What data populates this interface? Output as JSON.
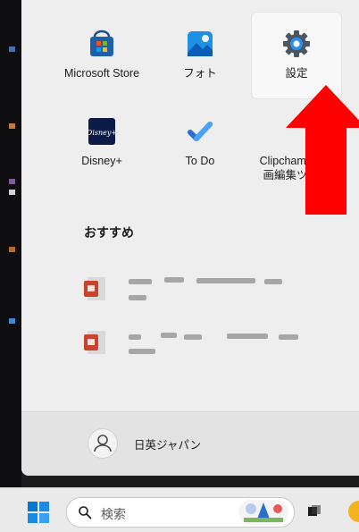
{
  "pinned_apps": [
    {
      "label": "Microsoft Store",
      "icon": "microsoft-store-icon"
    },
    {
      "label": "フォト",
      "icon": "photos-icon"
    },
    {
      "label": "設定",
      "icon": "settings-gear-icon"
    },
    {
      "label": "Disney+",
      "icon": "disney-plus-icon"
    },
    {
      "label": "To Do",
      "icon": "todo-check-icon"
    },
    {
      "label": "Clipchamp - 動",
      "label_line2": "画編集ツール",
      "icon": "clipchamp-icon"
    }
  ],
  "recommended": {
    "title": "おすすめ",
    "items": [
      {
        "icon": "office-document-icon"
      },
      {
        "icon": "office-document-icon"
      }
    ]
  },
  "user": {
    "name": "日英ジャパン"
  },
  "taskbar": {
    "search_placeholder": "検索"
  },
  "colors": {
    "arrow": "#ff0000",
    "start_blue": "#0078d4",
    "menu_bg": "#eeeeee"
  }
}
